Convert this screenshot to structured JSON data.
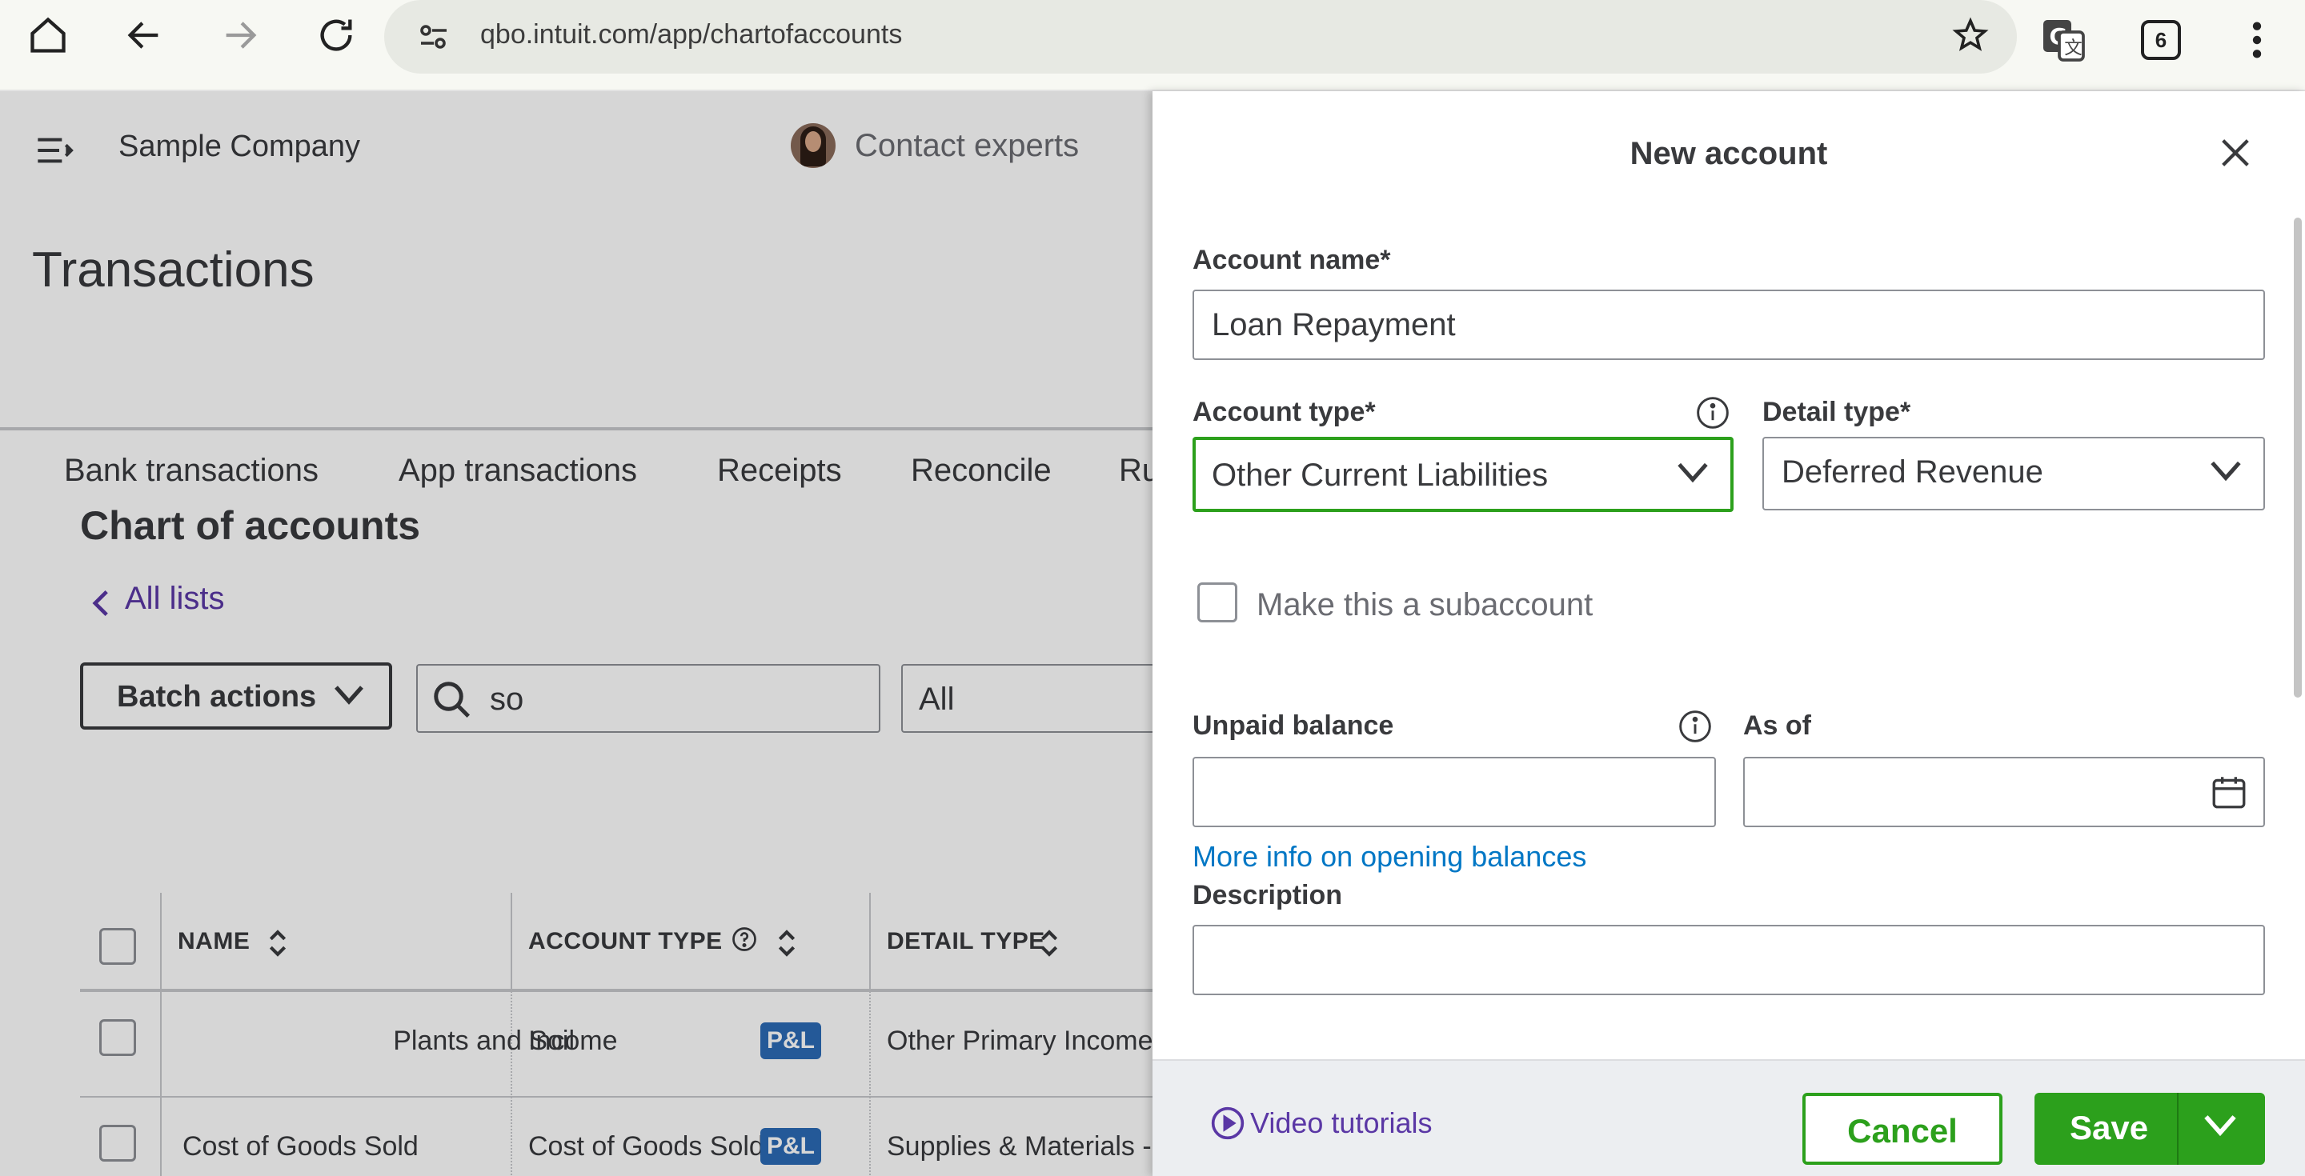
{
  "browser": {
    "url": "qbo.intuit.com/app/chartofaccounts",
    "tab_count": "6"
  },
  "app": {
    "company_name": "Sample Company",
    "contact_experts": "Contact experts",
    "page_title": "Transactions",
    "tabs": [
      {
        "label": "Bank transactions"
      },
      {
        "label": "App transactions"
      },
      {
        "label": "Receipts"
      },
      {
        "label": "Reconcile"
      },
      {
        "label": "Ru"
      }
    ],
    "section_title": "Chart of accounts",
    "all_lists": "All lists",
    "batch_actions": "Batch actions",
    "search_value": "so",
    "filter_value": "All",
    "table": {
      "headers": {
        "name": "NAME",
        "account_type": "ACCOUNT TYPE",
        "detail_type": "DETAIL TYPE"
      },
      "rows": [
        {
          "name": "Plants and Soil",
          "account_type": "Income",
          "badge": "P&L",
          "detail_type": "Other Primary Income"
        },
        {
          "name": "Cost of Goods Sold",
          "account_type": "Cost of Goods Sold",
          "badge": "P&L",
          "detail_type": "Supplies & Materials - C"
        }
      ]
    }
  },
  "drawer": {
    "title": "New account",
    "account_name_label": "Account name*",
    "account_name_value": "Loan Repayment",
    "account_type_label": "Account type*",
    "account_type_value": "Other Current Liabilities",
    "detail_type_label": "Detail type*",
    "detail_type_value": "Deferred Revenue",
    "subaccount_label": "Make this a subaccount",
    "unpaid_balance_label": "Unpaid balance",
    "as_of_label": "As of",
    "opening_balances_link": "More info on opening balances",
    "description_label": "Description",
    "video_tutorials": "Video tutorials",
    "cancel": "Cancel",
    "save": "Save"
  },
  "colors": {
    "accent_green": "#2ca01c",
    "link_blue": "#0077c5",
    "link_purple": "#5a37a5",
    "badge_blue": "#2c6ab6"
  }
}
